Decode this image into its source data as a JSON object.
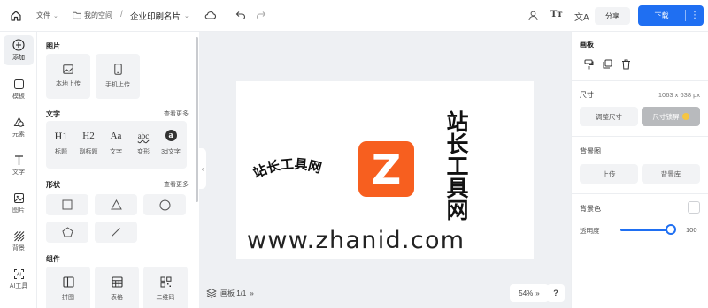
{
  "header": {
    "file_menu": "文件",
    "my_space": "我的空间",
    "breadcrumb_sep": "/",
    "doc_title": "企业印刷名片",
    "share_label": "分享",
    "download_label": "下载",
    "more_glyph": "⋮"
  },
  "rail": {
    "items": [
      {
        "label": "添加"
      },
      {
        "label": "模板"
      },
      {
        "label": "元素"
      },
      {
        "label": "文字"
      },
      {
        "label": "图片"
      },
      {
        "label": "背景"
      },
      {
        "label": "AI工具"
      }
    ]
  },
  "panel": {
    "images": {
      "title": "图片",
      "local_upload": "本地上传",
      "phone_upload": "手机上传"
    },
    "text": {
      "title": "文字",
      "more": "查看更多",
      "items": [
        {
          "glyph": "H1",
          "label": "标题"
        },
        {
          "glyph": "H2",
          "label": "副标题"
        },
        {
          "glyph": "Aa",
          "label": "文字"
        },
        {
          "glyph": "abc",
          "label": "变形"
        },
        {
          "glyph": "a",
          "label": "3d文字"
        }
      ]
    },
    "shapes": {
      "title": "形状",
      "more": "查看更多"
    },
    "components": {
      "title": "组件",
      "items": [
        {
          "label": "拼图"
        },
        {
          "label": "表格"
        },
        {
          "label": "二维码"
        }
      ]
    }
  },
  "canvas": {
    "vertical_text": [
      "站",
      "长",
      "工",
      "具",
      "网"
    ],
    "curved_text": "站长工具网",
    "logo_letter": "Z",
    "logo_color": "#f75f1f",
    "url_text": "www.zhanid.com",
    "page_label": "画板 1/1",
    "page_chevron": "»",
    "zoom": "54%",
    "help": "?"
  },
  "right_panel": {
    "artboard_title": "画板",
    "size_label": "尺寸",
    "size_value": "1063 x 638 px",
    "resize_button": "调整尺寸",
    "size_lock_button": "尺寸锁屏",
    "background_image_label": "背景图",
    "upload_button": "上传",
    "bg_library_button": "背景库",
    "bg_color_label": "背景色",
    "opacity_label": "透明度",
    "opacity_value": "100"
  },
  "colors": {
    "accent": "#1f6ff2",
    "canvas_bg": "#eef0f3"
  }
}
